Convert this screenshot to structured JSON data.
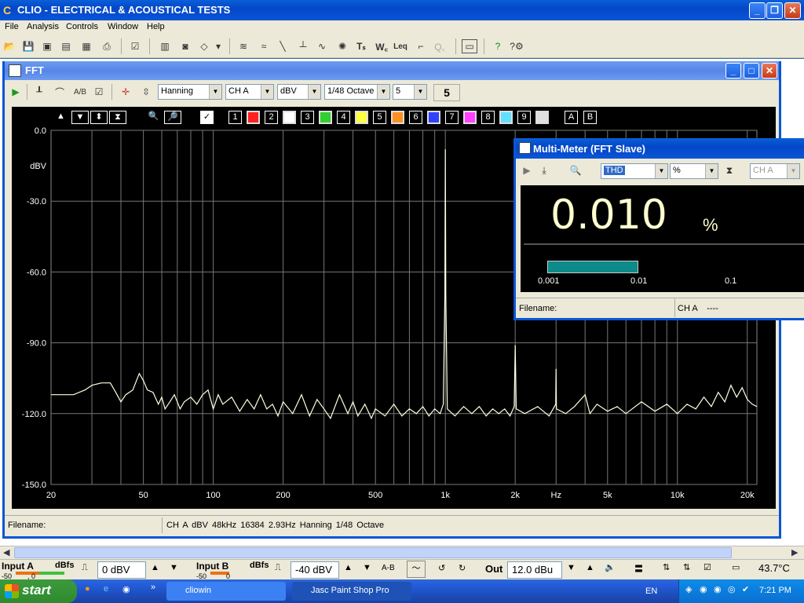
{
  "app": {
    "title": "CLIO - ELECTRICAL & ACOUSTICAL TESTS",
    "menu": [
      "File",
      "Analysis",
      "Controls",
      "Window",
      "Help"
    ]
  },
  "fft": {
    "title": "FFT",
    "window_combo": "Hanning",
    "channel_combo": "CH A",
    "unit_combo": "dBV",
    "smoothing_combo": "1/48 Octave",
    "avg_combo": "5",
    "avg_display": "5",
    "plot_buttons": [
      "1",
      "2",
      "3",
      "4",
      "5",
      "6",
      "7",
      "8",
      "9",
      "A",
      "B"
    ],
    "swatch_colors": [
      "#ff2020",
      "#ffffff",
      "#30d030",
      "#ffff40",
      "#ff9020",
      "#3040ff",
      "#ff40ff",
      "#60e0ff",
      "#e0e0e0"
    ],
    "status_filename": "Filename:",
    "status_info": "CH A   dBV   48kHz   16384   2.93Hz   Hanning   1/48 Octave"
  },
  "chart_data": {
    "type": "line",
    "ylabel": "dBV",
    "xlabel": "Hz",
    "y_ticks": [
      "0.0",
      "-30.0",
      "-60.0",
      "-90.0",
      "-120.0",
      "-150.0"
    ],
    "ylim": [
      -150,
      0
    ],
    "x_ticks": [
      "20",
      "50",
      "100",
      "200",
      "500",
      "1k",
      "2k",
      "Hz",
      "5k",
      "10k",
      "20k"
    ],
    "x_tick_values": [
      20,
      50,
      100,
      200,
      500,
      1000,
      2000,
      3000,
      5000,
      10000,
      20000
    ],
    "xlim": [
      20,
      22000
    ],
    "x_scale": "log",
    "grid": true,
    "series": [
      {
        "color": "#ffffe0",
        "points": [
          [
            20,
            -112
          ],
          [
            25,
            -112
          ],
          [
            28,
            -110
          ],
          [
            30,
            -108
          ],
          [
            33,
            -107
          ],
          [
            36,
            -107
          ],
          [
            38,
            -111
          ],
          [
            40,
            -115
          ],
          [
            42,
            -112
          ],
          [
            45,
            -110
          ],
          [
            48,
            -103
          ],
          [
            50,
            -106
          ],
          [
            52,
            -110
          ],
          [
            55,
            -111
          ],
          [
            58,
            -116
          ],
          [
            60,
            -113
          ],
          [
            62,
            -118
          ],
          [
            65,
            -115
          ],
          [
            68,
            -112
          ],
          [
            72,
            -118
          ],
          [
            75,
            -115
          ],
          [
            80,
            -113
          ],
          [
            85,
            -116
          ],
          [
            90,
            -112
          ],
          [
            95,
            -110
          ],
          [
            100,
            -118
          ],
          [
            105,
            -112
          ],
          [
            110,
            -116
          ],
          [
            120,
            -113
          ],
          [
            130,
            -119
          ],
          [
            140,
            -114
          ],
          [
            150,
            -118
          ],
          [
            160,
            -112
          ],
          [
            170,
            -118
          ],
          [
            180,
            -116
          ],
          [
            190,
            -121
          ],
          [
            200,
            -115
          ],
          [
            220,
            -120
          ],
          [
            240,
            -112
          ],
          [
            260,
            -121
          ],
          [
            280,
            -114
          ],
          [
            300,
            -118
          ],
          [
            320,
            -122
          ],
          [
            350,
            -112
          ],
          [
            380,
            -120
          ],
          [
            400,
            -115
          ],
          [
            420,
            -121
          ],
          [
            450,
            -116
          ],
          [
            480,
            -122
          ],
          [
            500,
            -118
          ],
          [
            550,
            -121
          ],
          [
            600,
            -116
          ],
          [
            650,
            -121
          ],
          [
            700,
            -118
          ],
          [
            750,
            -120
          ],
          [
            800,
            -117
          ],
          [
            850,
            -121
          ],
          [
            900,
            -118
          ],
          [
            950,
            -120
          ],
          [
            980,
            -116
          ],
          [
            995,
            -70
          ],
          [
            1000,
            -8
          ],
          [
            1005,
            -70
          ],
          [
            1020,
            -118
          ],
          [
            1100,
            -121
          ],
          [
            1200,
            -117
          ],
          [
            1300,
            -120
          ],
          [
            1400,
            -117
          ],
          [
            1500,
            -121
          ],
          [
            1600,
            -118
          ],
          [
            1700,
            -120
          ],
          [
            1800,
            -118
          ],
          [
            1900,
            -121
          ],
          [
            1980,
            -117
          ],
          [
            2000,
            -91
          ],
          [
            2020,
            -118
          ],
          [
            2200,
            -120
          ],
          [
            2500,
            -117
          ],
          [
            2800,
            -121
          ],
          [
            2990,
            -116
          ],
          [
            3000,
            -101
          ],
          [
            3010,
            -118
          ],
          [
            3300,
            -120
          ],
          [
            3600,
            -117
          ],
          [
            4000,
            -112
          ],
          [
            4200,
            -120
          ],
          [
            4500,
            -116
          ],
          [
            5000,
            -119
          ],
          [
            5500,
            -117
          ],
          [
            6000,
            -120
          ],
          [
            7000,
            -115
          ],
          [
            8000,
            -119
          ],
          [
            9000,
            -116
          ],
          [
            10000,
            -120
          ],
          [
            11000,
            -116
          ],
          [
            12000,
            -118
          ],
          [
            13000,
            -113
          ],
          [
            14000,
            -117
          ],
          [
            15000,
            -111
          ],
          [
            16000,
            -115
          ],
          [
            17000,
            -108
          ],
          [
            18000,
            -113
          ],
          [
            19000,
            -109
          ],
          [
            20000,
            -114
          ],
          [
            21000,
            -116
          ],
          [
            22000,
            -117
          ]
        ]
      }
    ]
  },
  "multimeter": {
    "title": "Multi-Meter (FFT Slave)",
    "param_combo": "THD",
    "unit_combo": "%",
    "channel_combo": "CH A",
    "value": "0.010",
    "unit": "%",
    "scale_labels": [
      "0.001",
      "0.01",
      "0.1"
    ],
    "bar_fraction": 0.5,
    "filename_label": "Filename:",
    "channel_info": "CH A    ----"
  },
  "io": {
    "input_a_label": "Input A",
    "input_a_dbfs": "dBfs",
    "input_a_scale": "-50        , 0",
    "input_a_level": "0 dBV",
    "input_b_label": "Input B",
    "input_b_dbfs": "dBfs",
    "input_b_scale": "-50          0",
    "input_b_level": "-40 dBV",
    "ab_label": "A-B",
    "out_label": "Out",
    "out_level": "12.0 dBu",
    "temperature": "43.7°C"
  },
  "taskbar": {
    "start_label": "start",
    "tasks": [
      "cliowin",
      "Jasc Paint Shop Pro"
    ],
    "lang": "EN",
    "clock": "7:21 PM"
  }
}
